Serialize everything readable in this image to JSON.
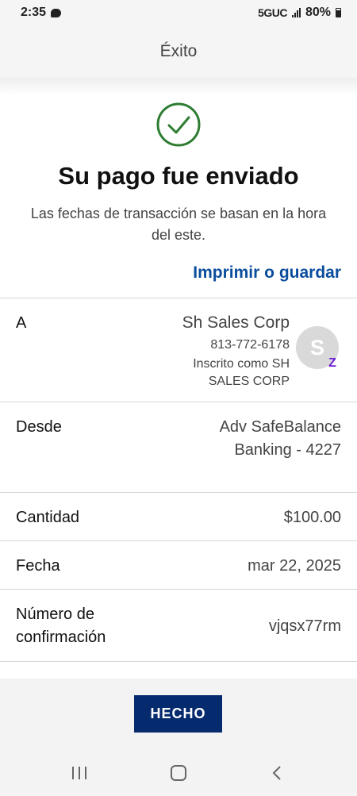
{
  "status_bar": {
    "time": "2:35",
    "network": "5GUC",
    "battery": "80%"
  },
  "header": {
    "title": "Éxito"
  },
  "confirmation": {
    "title": "Su pago fue enviado",
    "subtitle": "Las fechas de transacción se basan en la hora del este.",
    "print_link": "Imprimir o guardar"
  },
  "details": {
    "to": {
      "label": "A",
      "name": "Sh Sales Corp",
      "phone": "813-772-6178",
      "enrolled": "Inscrito como SH SALES CORP",
      "avatar_initial": "S"
    },
    "from": {
      "label": "Desde",
      "value_line1": "Adv SafeBalance",
      "value_line2": "Banking - 4227"
    },
    "amount": {
      "label": "Cantidad",
      "value": "$100.00"
    },
    "date": {
      "label": "Fecha",
      "value": "mar 22, 2025"
    },
    "confirmation_number": {
      "label_line1": "Número de",
      "label_line2": "confirmación",
      "value": "vjqsx77rm"
    }
  },
  "actions": {
    "done_label": "HECHO"
  },
  "colors": {
    "link": "#0a4d9c",
    "button": "#062a6e",
    "success": "#2e7d32",
    "zelle": "#6d1ed4"
  },
  "icons": {
    "success": "check-circle-icon",
    "recents": "recents-icon",
    "home": "home-icon",
    "back": "back-icon"
  }
}
